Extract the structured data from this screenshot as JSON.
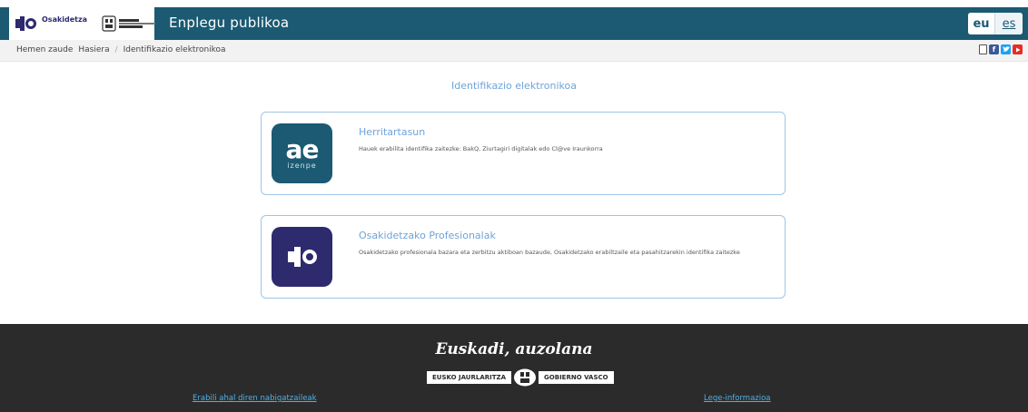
{
  "header": {
    "brand": "Osakidetza",
    "title": "Enplegu publikoa",
    "languages": [
      {
        "code": "eu",
        "active": true
      },
      {
        "code": "es",
        "active": false
      }
    ]
  },
  "breadcrumb": {
    "items": [
      "Hemen zaude",
      "Hasiera",
      "/",
      "Identifikazio elektronikoa"
    ]
  },
  "social_icons": [
    "mobile-icon",
    "facebook-icon",
    "twitter-icon",
    "youtube-icon"
  ],
  "main": {
    "title": "Identifikazio elektronikoa",
    "cards": [
      {
        "icon_text": "ae",
        "icon_subtext": "izenpe",
        "heading": "Herritartasun",
        "description": "Hauek erabilita identifika zaitezke: BakQ, Ziurtagiri digitalak edo Cl@ve Iraunkorra"
      },
      {
        "heading": "Osakidetzako Profesionalak",
        "description": "Osakidetzako profesionala bazara eta zerbitzu aktiboan bazaude, Osakidetzako erabiltzaile eta pasahitzarekin identifika zaitezke"
      }
    ]
  },
  "footer": {
    "slogan": "Euskadi, auzolana",
    "gov_left": "EUSKO JAURLARITZA",
    "gov_right": "GOBIERNO VASCO",
    "links": [
      "Erabili ahal diren nabigatzaileak",
      "Lege-informazioa"
    ]
  },
  "colors": {
    "header_bg": "#1b5a72",
    "accent": "#6fa3d8",
    "osakidetza_purple": "#2d2a6e",
    "footer_bg": "#2b2b2b",
    "footer_link": "#4fb0e8"
  }
}
